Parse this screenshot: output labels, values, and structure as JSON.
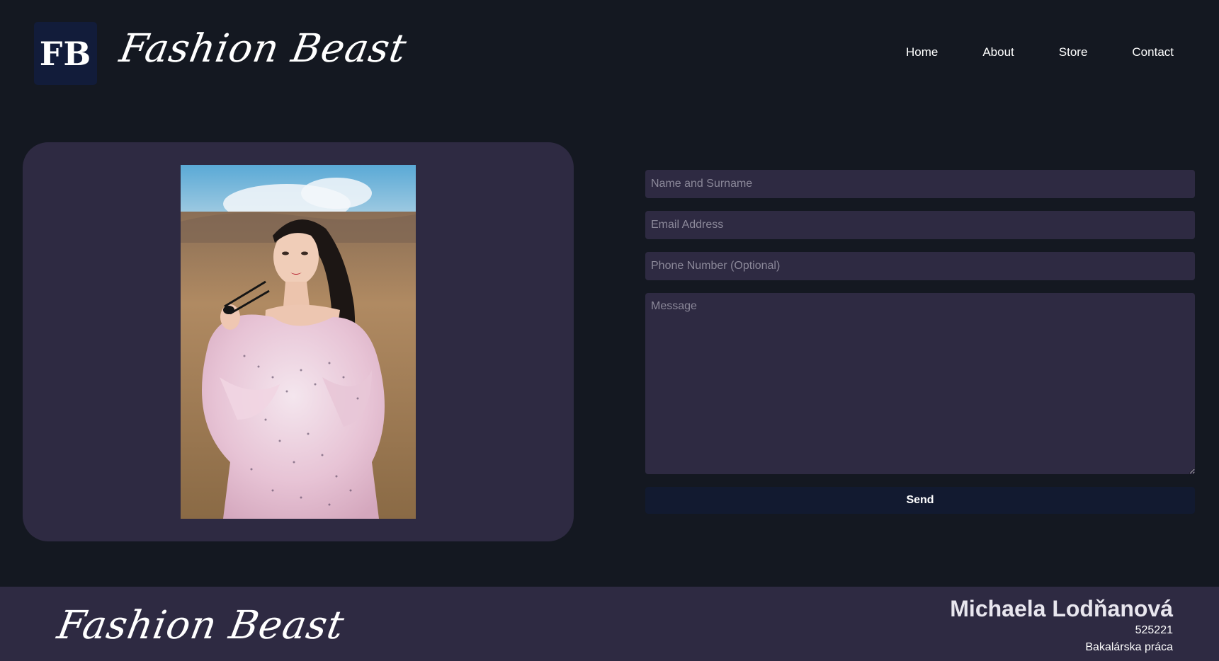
{
  "header": {
    "logo_text": "FB",
    "brand": "Fashion Beast",
    "nav": [
      {
        "label": "Home"
      },
      {
        "label": "About"
      },
      {
        "label": "Store"
      },
      {
        "label": "Contact"
      }
    ]
  },
  "photo": {
    "description_icon": "fashion-photo"
  },
  "form": {
    "name_placeholder": "Name and Surname",
    "email_placeholder": "Email Address",
    "phone_placeholder": "Phone Number (Optional)",
    "message_placeholder": "Message",
    "send_label": "Send"
  },
  "footer": {
    "brand": "Fashion Beast",
    "author": "Michaela Lodňanová",
    "id": "525221",
    "thesis": "Bakalárska práca"
  },
  "colors": {
    "background": "#141821",
    "panel": "#2e2a42",
    "button": "#121a30",
    "logo_badge": "#121c3a"
  }
}
